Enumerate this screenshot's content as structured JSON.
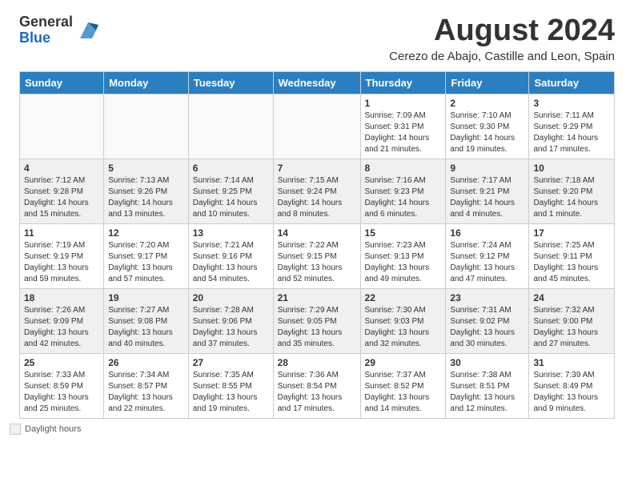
{
  "header": {
    "logo_general": "General",
    "logo_blue": "Blue",
    "main_title": "August 2024",
    "subtitle": "Cerezo de Abajo, Castille and Leon, Spain"
  },
  "legend": {
    "text": "Daylight hours"
  },
  "days_of_week": [
    "Sunday",
    "Monday",
    "Tuesday",
    "Wednesday",
    "Thursday",
    "Friday",
    "Saturday"
  ],
  "weeks": [
    [
      {
        "day": "",
        "info": "",
        "empty": true
      },
      {
        "day": "",
        "info": "",
        "empty": true
      },
      {
        "day": "",
        "info": "",
        "empty": true
      },
      {
        "day": "",
        "info": "",
        "empty": true
      },
      {
        "day": "1",
        "info": "Sunrise: 7:09 AM\nSunset: 9:31 PM\nDaylight: 14 hours and 21 minutes.",
        "empty": false
      },
      {
        "day": "2",
        "info": "Sunrise: 7:10 AM\nSunset: 9:30 PM\nDaylight: 14 hours and 19 minutes.",
        "empty": false
      },
      {
        "day": "3",
        "info": "Sunrise: 7:11 AM\nSunset: 9:29 PM\nDaylight: 14 hours and 17 minutes.",
        "empty": false
      }
    ],
    [
      {
        "day": "4",
        "info": "Sunrise: 7:12 AM\nSunset: 9:28 PM\nDaylight: 14 hours and 15 minutes.",
        "empty": false
      },
      {
        "day": "5",
        "info": "Sunrise: 7:13 AM\nSunset: 9:26 PM\nDaylight: 14 hours and 13 minutes.",
        "empty": false
      },
      {
        "day": "6",
        "info": "Sunrise: 7:14 AM\nSunset: 9:25 PM\nDaylight: 14 hours and 10 minutes.",
        "empty": false
      },
      {
        "day": "7",
        "info": "Sunrise: 7:15 AM\nSunset: 9:24 PM\nDaylight: 14 hours and 8 minutes.",
        "empty": false
      },
      {
        "day": "8",
        "info": "Sunrise: 7:16 AM\nSunset: 9:23 PM\nDaylight: 14 hours and 6 minutes.",
        "empty": false
      },
      {
        "day": "9",
        "info": "Sunrise: 7:17 AM\nSunset: 9:21 PM\nDaylight: 14 hours and 4 minutes.",
        "empty": false
      },
      {
        "day": "10",
        "info": "Sunrise: 7:18 AM\nSunset: 9:20 PM\nDaylight: 14 hours and 1 minute.",
        "empty": false
      }
    ],
    [
      {
        "day": "11",
        "info": "Sunrise: 7:19 AM\nSunset: 9:19 PM\nDaylight: 13 hours and 59 minutes.",
        "empty": false
      },
      {
        "day": "12",
        "info": "Sunrise: 7:20 AM\nSunset: 9:17 PM\nDaylight: 13 hours and 57 minutes.",
        "empty": false
      },
      {
        "day": "13",
        "info": "Sunrise: 7:21 AM\nSunset: 9:16 PM\nDaylight: 13 hours and 54 minutes.",
        "empty": false
      },
      {
        "day": "14",
        "info": "Sunrise: 7:22 AM\nSunset: 9:15 PM\nDaylight: 13 hours and 52 minutes.",
        "empty": false
      },
      {
        "day": "15",
        "info": "Sunrise: 7:23 AM\nSunset: 9:13 PM\nDaylight: 13 hours and 49 minutes.",
        "empty": false
      },
      {
        "day": "16",
        "info": "Sunrise: 7:24 AM\nSunset: 9:12 PM\nDaylight: 13 hours and 47 minutes.",
        "empty": false
      },
      {
        "day": "17",
        "info": "Sunrise: 7:25 AM\nSunset: 9:11 PM\nDaylight: 13 hours and 45 minutes.",
        "empty": false
      }
    ],
    [
      {
        "day": "18",
        "info": "Sunrise: 7:26 AM\nSunset: 9:09 PM\nDaylight: 13 hours and 42 minutes.",
        "empty": false
      },
      {
        "day": "19",
        "info": "Sunrise: 7:27 AM\nSunset: 9:08 PM\nDaylight: 13 hours and 40 minutes.",
        "empty": false
      },
      {
        "day": "20",
        "info": "Sunrise: 7:28 AM\nSunset: 9:06 PM\nDaylight: 13 hours and 37 minutes.",
        "empty": false
      },
      {
        "day": "21",
        "info": "Sunrise: 7:29 AM\nSunset: 9:05 PM\nDaylight: 13 hours and 35 minutes.",
        "empty": false
      },
      {
        "day": "22",
        "info": "Sunrise: 7:30 AM\nSunset: 9:03 PM\nDaylight: 13 hours and 32 minutes.",
        "empty": false
      },
      {
        "day": "23",
        "info": "Sunrise: 7:31 AM\nSunset: 9:02 PM\nDaylight: 13 hours and 30 minutes.",
        "empty": false
      },
      {
        "day": "24",
        "info": "Sunrise: 7:32 AM\nSunset: 9:00 PM\nDaylight: 13 hours and 27 minutes.",
        "empty": false
      }
    ],
    [
      {
        "day": "25",
        "info": "Sunrise: 7:33 AM\nSunset: 8:59 PM\nDaylight: 13 hours and 25 minutes.",
        "empty": false
      },
      {
        "day": "26",
        "info": "Sunrise: 7:34 AM\nSunset: 8:57 PM\nDaylight: 13 hours and 22 minutes.",
        "empty": false
      },
      {
        "day": "27",
        "info": "Sunrise: 7:35 AM\nSunset: 8:55 PM\nDaylight: 13 hours and 19 minutes.",
        "empty": false
      },
      {
        "day": "28",
        "info": "Sunrise: 7:36 AM\nSunset: 8:54 PM\nDaylight: 13 hours and 17 minutes.",
        "empty": false
      },
      {
        "day": "29",
        "info": "Sunrise: 7:37 AM\nSunset: 8:52 PM\nDaylight: 13 hours and 14 minutes.",
        "empty": false
      },
      {
        "day": "30",
        "info": "Sunrise: 7:38 AM\nSunset: 8:51 PM\nDaylight: 13 hours and 12 minutes.",
        "empty": false
      },
      {
        "day": "31",
        "info": "Sunrise: 7:39 AM\nSunset: 8:49 PM\nDaylight: 13 hours and 9 minutes.",
        "empty": false
      }
    ]
  ]
}
